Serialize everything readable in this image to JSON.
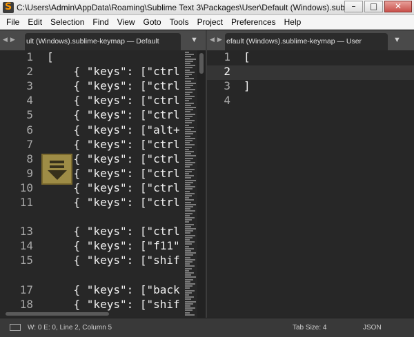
{
  "window": {
    "title": "C:\\Users\\Admin\\AppData\\Roaming\\Sublime Text 3\\Packages\\User\\Default (Windows).sublime-...",
    "controls": [
      "–",
      "□",
      "✕"
    ]
  },
  "menu": [
    "File",
    "Edit",
    "Selection",
    "Find",
    "View",
    "Goto",
    "Tools",
    "Project",
    "Preferences",
    "Help"
  ],
  "left_pane": {
    "tab_label": "ult (Windows).sublime-keymap — Default",
    "lines": [
      {
        "n": "1",
        "text": "["
      },
      {
        "n": "2",
        "text": "    { \"keys\": [\"ctrl"
      },
      {
        "n": "3",
        "text": "    { \"keys\": [\"ctrl"
      },
      {
        "n": "4",
        "text": "    { \"keys\": [\"ctrl"
      },
      {
        "n": "5",
        "text": "    { \"keys\": [\"ctrl"
      },
      {
        "n": "6",
        "text": "    { \"keys\": [\"alt+"
      },
      {
        "n": "7",
        "text": "    { \"keys\": [\"ctrl"
      },
      {
        "n": "8",
        "text": "    { \"keys\": [\"ctrl"
      },
      {
        "n": "9",
        "text": "    { \"keys\": [\"ctrl"
      },
      {
        "n": "10",
        "text": "    { \"keys\": [\"ctrl"
      },
      {
        "n": "11",
        "text": "    { \"keys\": [\"ctrl"
      },
      {
        "n": "",
        "text": ""
      },
      {
        "n": "13",
        "text": "    { \"keys\": [\"ctrl"
      },
      {
        "n": "14",
        "text": "    { \"keys\": [\"f11\""
      },
      {
        "n": "15",
        "text": "    { \"keys\": [\"shif"
      },
      {
        "n": "",
        "text": ""
      },
      {
        "n": "17",
        "text": "    { \"keys\": [\"back"
      },
      {
        "n": "18",
        "text": "    { \"keys\": [\"shif"
      }
    ]
  },
  "right_pane": {
    "tab_label": "efault (Windows).sublime-keymap — User",
    "lines": [
      {
        "n": "1",
        "text": "["
      },
      {
        "n": "2",
        "text": ""
      },
      {
        "n": "3",
        "text": "]"
      },
      {
        "n": "4",
        "text": ""
      }
    ],
    "current_line": 2
  },
  "status": {
    "position": "W: 0 E: 0, Line 2, Column 5",
    "tab_size": "Tab Size: 4",
    "syntax": "JSON"
  },
  "colors": {
    "editor_bg": "#272727",
    "save_indicator": "#b39e4c"
  }
}
